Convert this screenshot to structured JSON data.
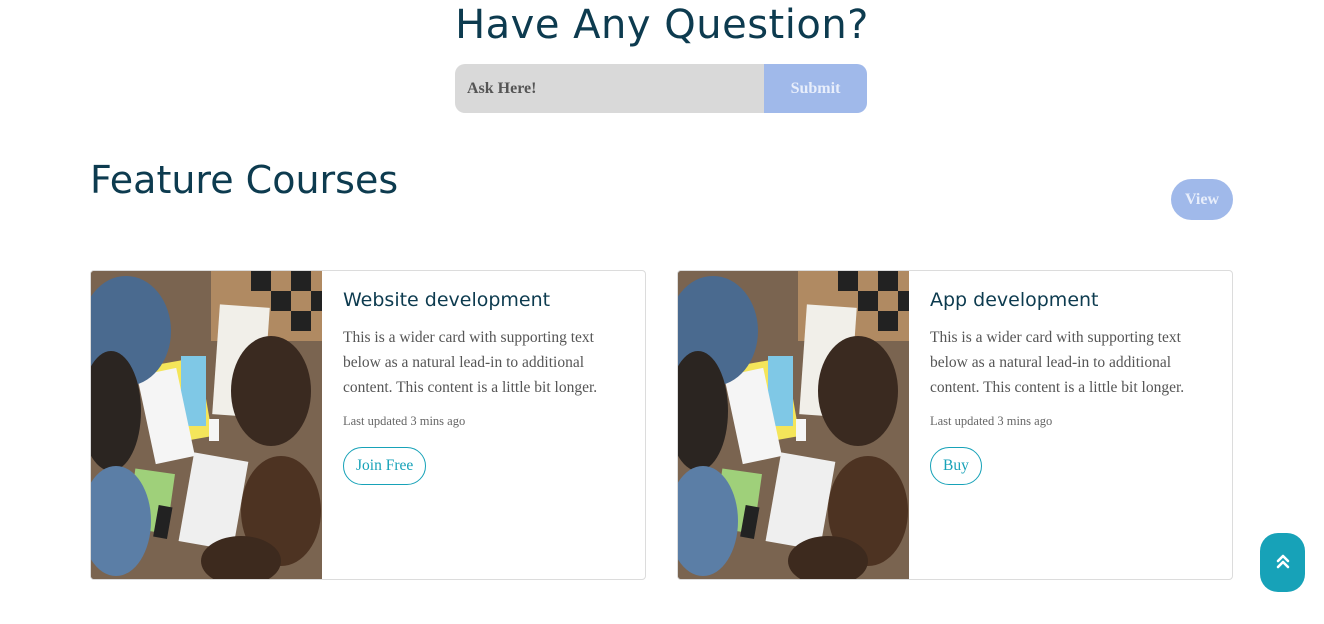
{
  "question": {
    "title": "Have Any Question?",
    "input_placeholder": "Ask Here!",
    "submit_label": "Submit"
  },
  "features": {
    "title": "Feature Courses",
    "view_label": "View",
    "cards": [
      {
        "title": "Website development",
        "text": "This is a wider card with supporting text below as a natural lead-in to additional content. This content is a little bit longer.",
        "meta": "Last updated 3 mins ago",
        "button_label": "Join Free"
      },
      {
        "title": "App development",
        "text": "This is a wider card with supporting text below as a natural lead-in to additional content. This content is a little bit longer.",
        "meta": "Last updated 3 mins ago",
        "button_label": "Buy"
      }
    ]
  },
  "scroll_top": {
    "icon": "double-chevron-up-icon"
  },
  "colors": {
    "heading": "#0d3b4f",
    "accent": "#17a2b8",
    "muted_button": "#a0b9ea",
    "input_bg": "#d9d9d9"
  }
}
